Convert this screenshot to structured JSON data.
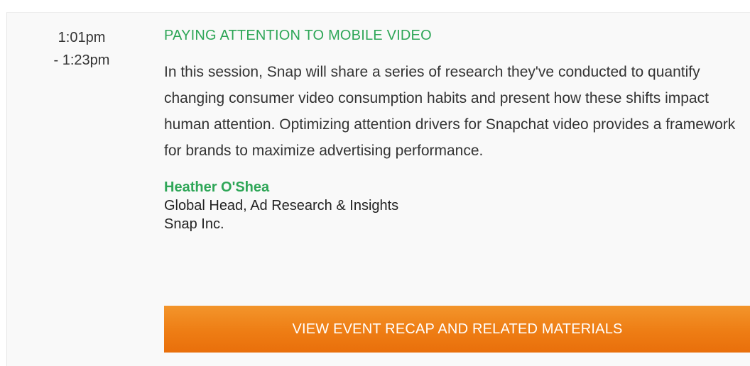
{
  "session": {
    "time_start": "1:01pm",
    "time_end": "- 1:23pm",
    "title": "PAYING ATTENTION TO MOBILE VIDEO",
    "description": "In this session, Snap will share a series of research they've conducted to quantify changing consumer video consumption habits and present how these shifts impact human attention. Optimizing attention drivers for Snapchat video provides a framework for brands to maximize advertising performance.",
    "speaker": {
      "name": "Heather O'Shea",
      "role": "Global Head, Ad Research & Insights",
      "organization": "Snap Inc."
    },
    "cta_label": "VIEW EVENT RECAP AND RELATED MATERIALS"
  },
  "colors": {
    "accent_green": "#2ea657",
    "button_orange": "#ee7d14",
    "text": "#333333",
    "panel_bg": "#f9f9f9"
  }
}
